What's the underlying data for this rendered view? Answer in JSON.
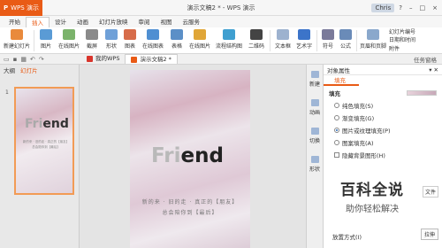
{
  "titlebar": {
    "app_name": "WPS 演示",
    "window_title": "演示文稿2 * - WPS 演示",
    "user": "Chris",
    "controls": [
      "?",
      "–",
      "□",
      "×"
    ]
  },
  "menu_tabs": [
    {
      "label": "开始",
      "active": false
    },
    {
      "label": "插入",
      "active": true
    },
    {
      "label": "设计",
      "active": false
    },
    {
      "label": "动画",
      "active": false
    },
    {
      "label": "幻灯片放映",
      "active": false
    },
    {
      "label": "审阅",
      "active": false
    },
    {
      "label": "视图",
      "active": false
    },
    {
      "label": "云服务",
      "active": false
    }
  ],
  "ribbon": {
    "new_slide": "新建幻灯片",
    "picture": "图片",
    "online_picture": "在线图片",
    "screenshot": "截屏",
    "shapes": "形状",
    "chart": "图表",
    "online_chart": "在线图表",
    "table": "表格",
    "smartart": "在线图片",
    "mind_map": "流程结构图",
    "qrcode": "二维码",
    "textbox": "文本框",
    "art_text": "艺术字",
    "symbol": "符号",
    "formula": "公式",
    "header_footer": "页眉和页脚",
    "slide_number": "幻灯片编号",
    "date_time": "日期和时间",
    "attachment": "附件"
  },
  "doc_tabs": [
    {
      "label": "我的WPS",
      "active": false
    },
    {
      "label": "演示文稿2 *",
      "active": true
    }
  ],
  "task_pane_label": "任务窗格",
  "left_panel": {
    "tabs": [
      "大纲",
      "幻灯片"
    ],
    "slide_number": "1"
  },
  "slide": {
    "title_light": "Fri",
    "title_dark": "end",
    "line1": "新的来 · 旧的走 · 真正的【朋友】",
    "line2": "总会陪你到【最后】"
  },
  "side_tabs": [
    "新建",
    "动画",
    "切换",
    "形状"
  ],
  "properties": {
    "header": "对象属性",
    "tab": "填充",
    "section": "填充",
    "options": [
      {
        "label": "纯色填充(S)",
        "type": "radio",
        "selected": false
      },
      {
        "label": "渐变填充(G)",
        "type": "radio",
        "selected": false
      },
      {
        "label": "图片或纹理填充(P)",
        "type": "radio",
        "selected": true
      },
      {
        "label": "图案填充(A)",
        "type": "radio",
        "selected": false
      },
      {
        "label": "隐藏背景图形(H)",
        "type": "checkbox",
        "selected": false
      }
    ],
    "file_button": "文件",
    "layout_label": "放置方式(I)",
    "stretch_button": "拉伸"
  },
  "watermark": {
    "title": "百科全说",
    "subtitle": "助你轻松解决"
  }
}
